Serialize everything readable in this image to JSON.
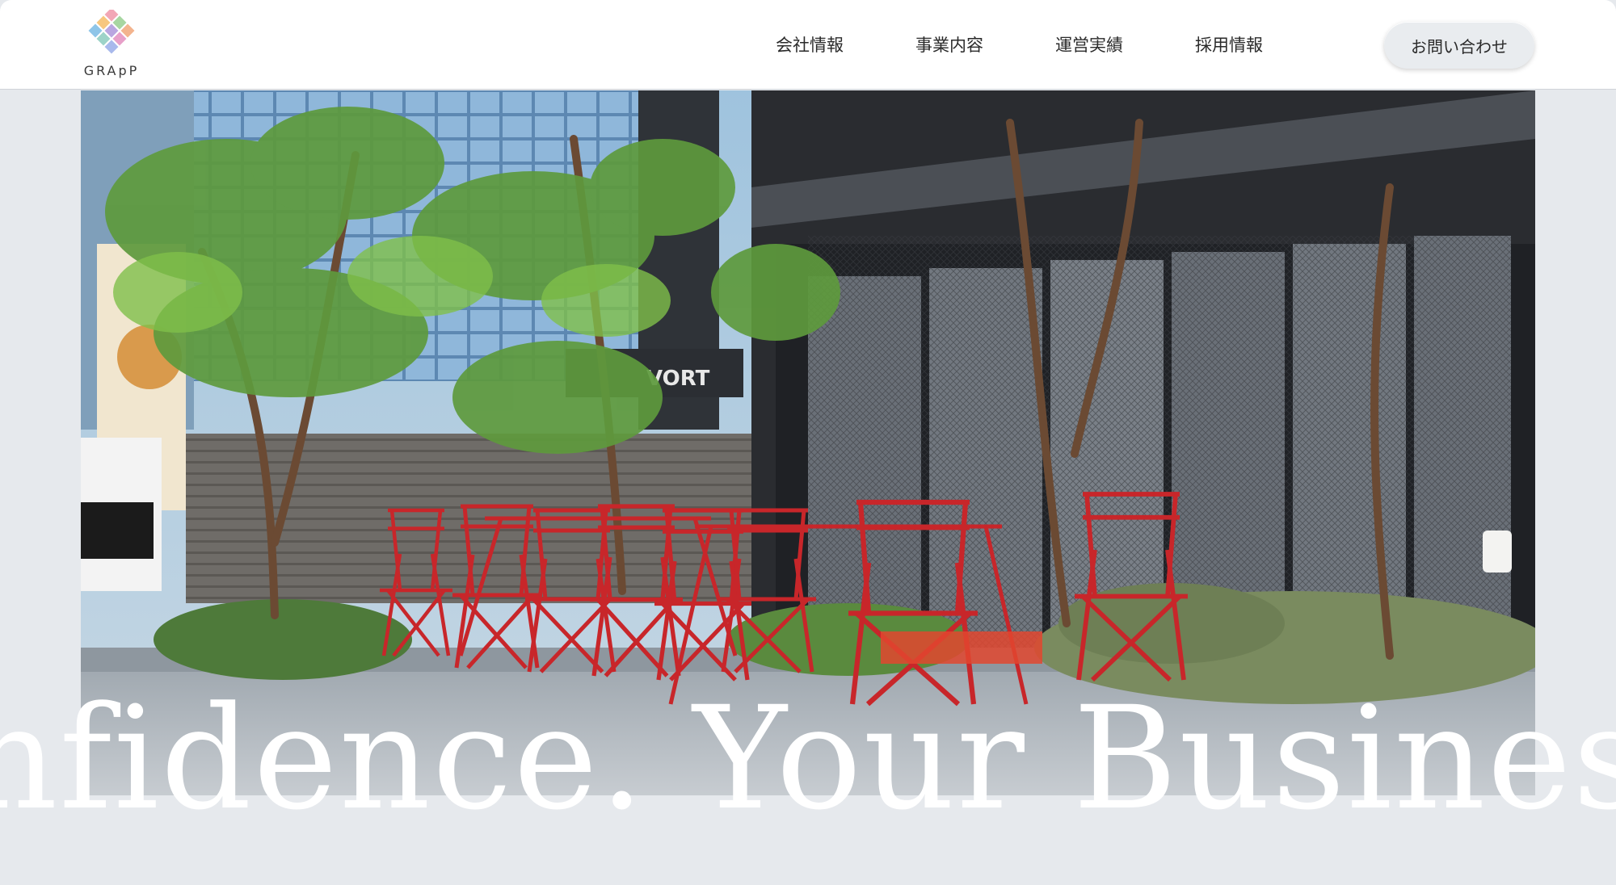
{
  "brand": {
    "name": "GRApP",
    "logo_colors": [
      "#f2a7b6",
      "#f7c77e",
      "#a7d6a1",
      "#8ec5e8",
      "#b9a6e0",
      "#f3b48e",
      "#9dd3c8",
      "#e7a0c9",
      "#a8b9ec"
    ]
  },
  "nav": {
    "items": [
      {
        "label": "会社情報"
      },
      {
        "label": "事業内容"
      },
      {
        "label": "運営実績"
      },
      {
        "label": "採用情報"
      }
    ],
    "contact_label": "お問い合わせ"
  },
  "hero": {
    "image_icon": "terrace-cafe-photo",
    "marquee_text": "nfidence.  Your Business P"
  },
  "colors": {
    "background": "#e6e9ed",
    "header_bg": "#ffffff",
    "chair_red": "#c8262a",
    "text": "#2a2a2a"
  }
}
